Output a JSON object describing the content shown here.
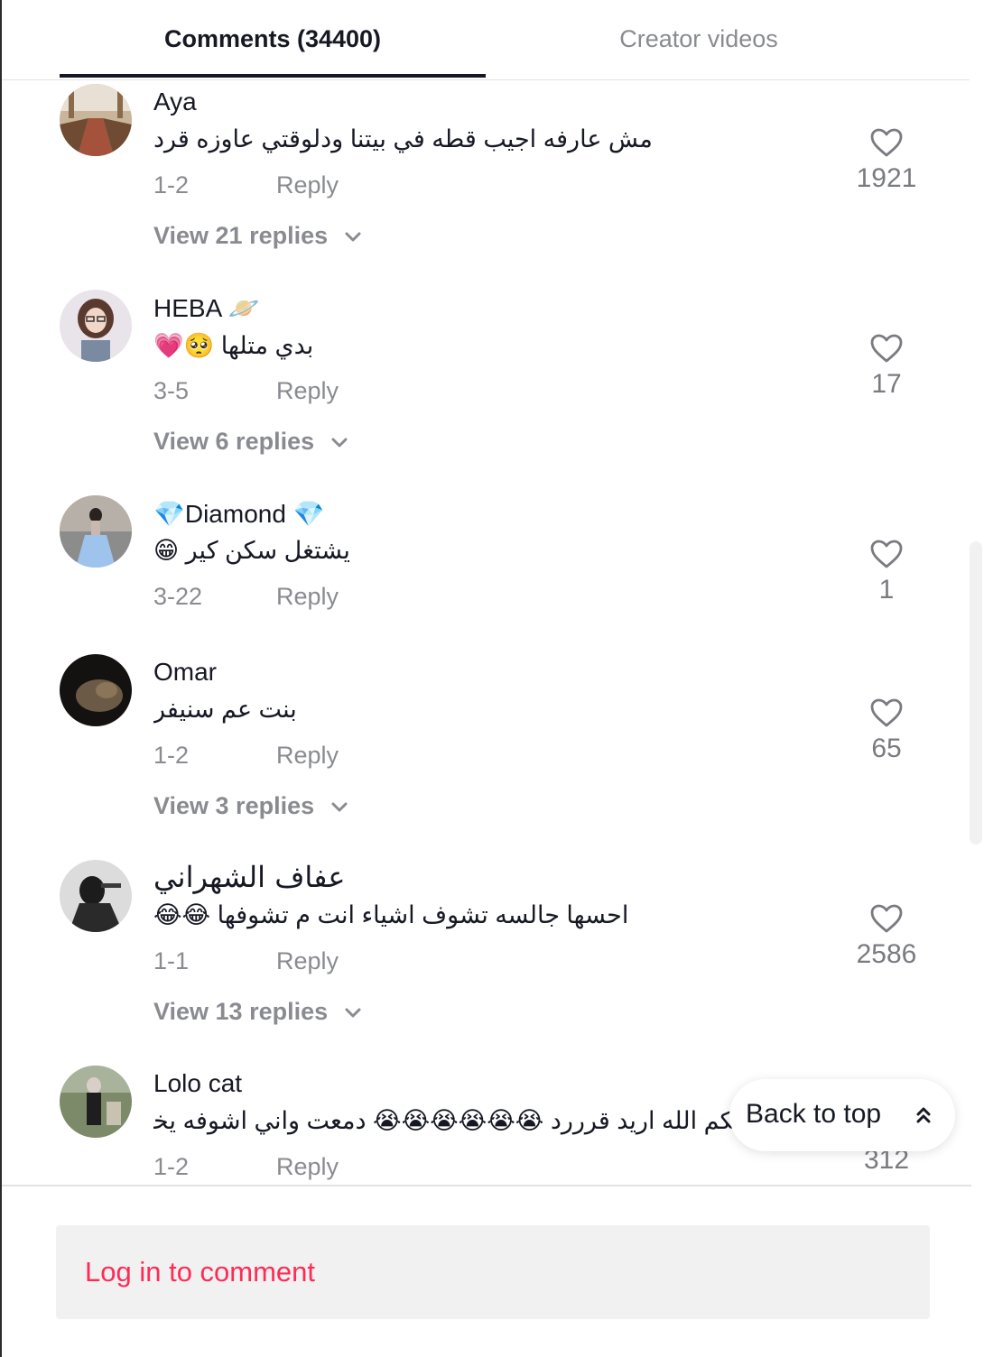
{
  "tabs": {
    "comments": "Comments (34400)",
    "creator": "Creator videos"
  },
  "comments": [
    {
      "username": "Aya",
      "text": "مش عارفه اجيب قطه في بيتنا ودلوقتي عاوزه قرد",
      "date": "1-2",
      "reply": "Reply",
      "likes": "1921",
      "view_replies": "View 21 replies"
    },
    {
      "username": "HEBA 🪐",
      "text": "بدي متلها 🥺💗",
      "date": "3-5",
      "reply": "Reply",
      "likes": "17",
      "view_replies": "View 6 replies"
    },
    {
      "username": "💎Diamond 💎",
      "text": "يشتغل سكن كير 😁",
      "date": "3-22",
      "reply": "Reply",
      "likes": "1"
    },
    {
      "username": "Omar",
      "text": "بنت عم سنيفر",
      "date": "1-2",
      "reply": "Reply",
      "likes": "65",
      "view_replies": "View 3 replies"
    },
    {
      "username": "عفاف الشهراني",
      "text": "احسها جالسه تشوف اشياء انت م تشوفها 😂😂",
      "date": "1-1",
      "reply": "Reply",
      "likes": "2586",
      "view_replies": "View 13 replies"
    },
    {
      "username": "Lolo cat",
      "text": "يكم الله اريد قرررد 😭😭😭😭😭😭 دمعت واني اشوفه يخبل",
      "date": "1-2",
      "reply": "Reply",
      "likes": "312"
    }
  ],
  "back_to_top": "Back to top",
  "login_prompt": "Log in to comment",
  "colors": {
    "accent": "#fe2c55",
    "text_primary": "#161823",
    "text_secondary": "#8a8b91",
    "input_bg": "#f1f1f2"
  },
  "icons": {
    "like": "heart-outline-icon",
    "expand": "chevron-down-icon",
    "back_to_top": "double-chevron-up-icon"
  }
}
